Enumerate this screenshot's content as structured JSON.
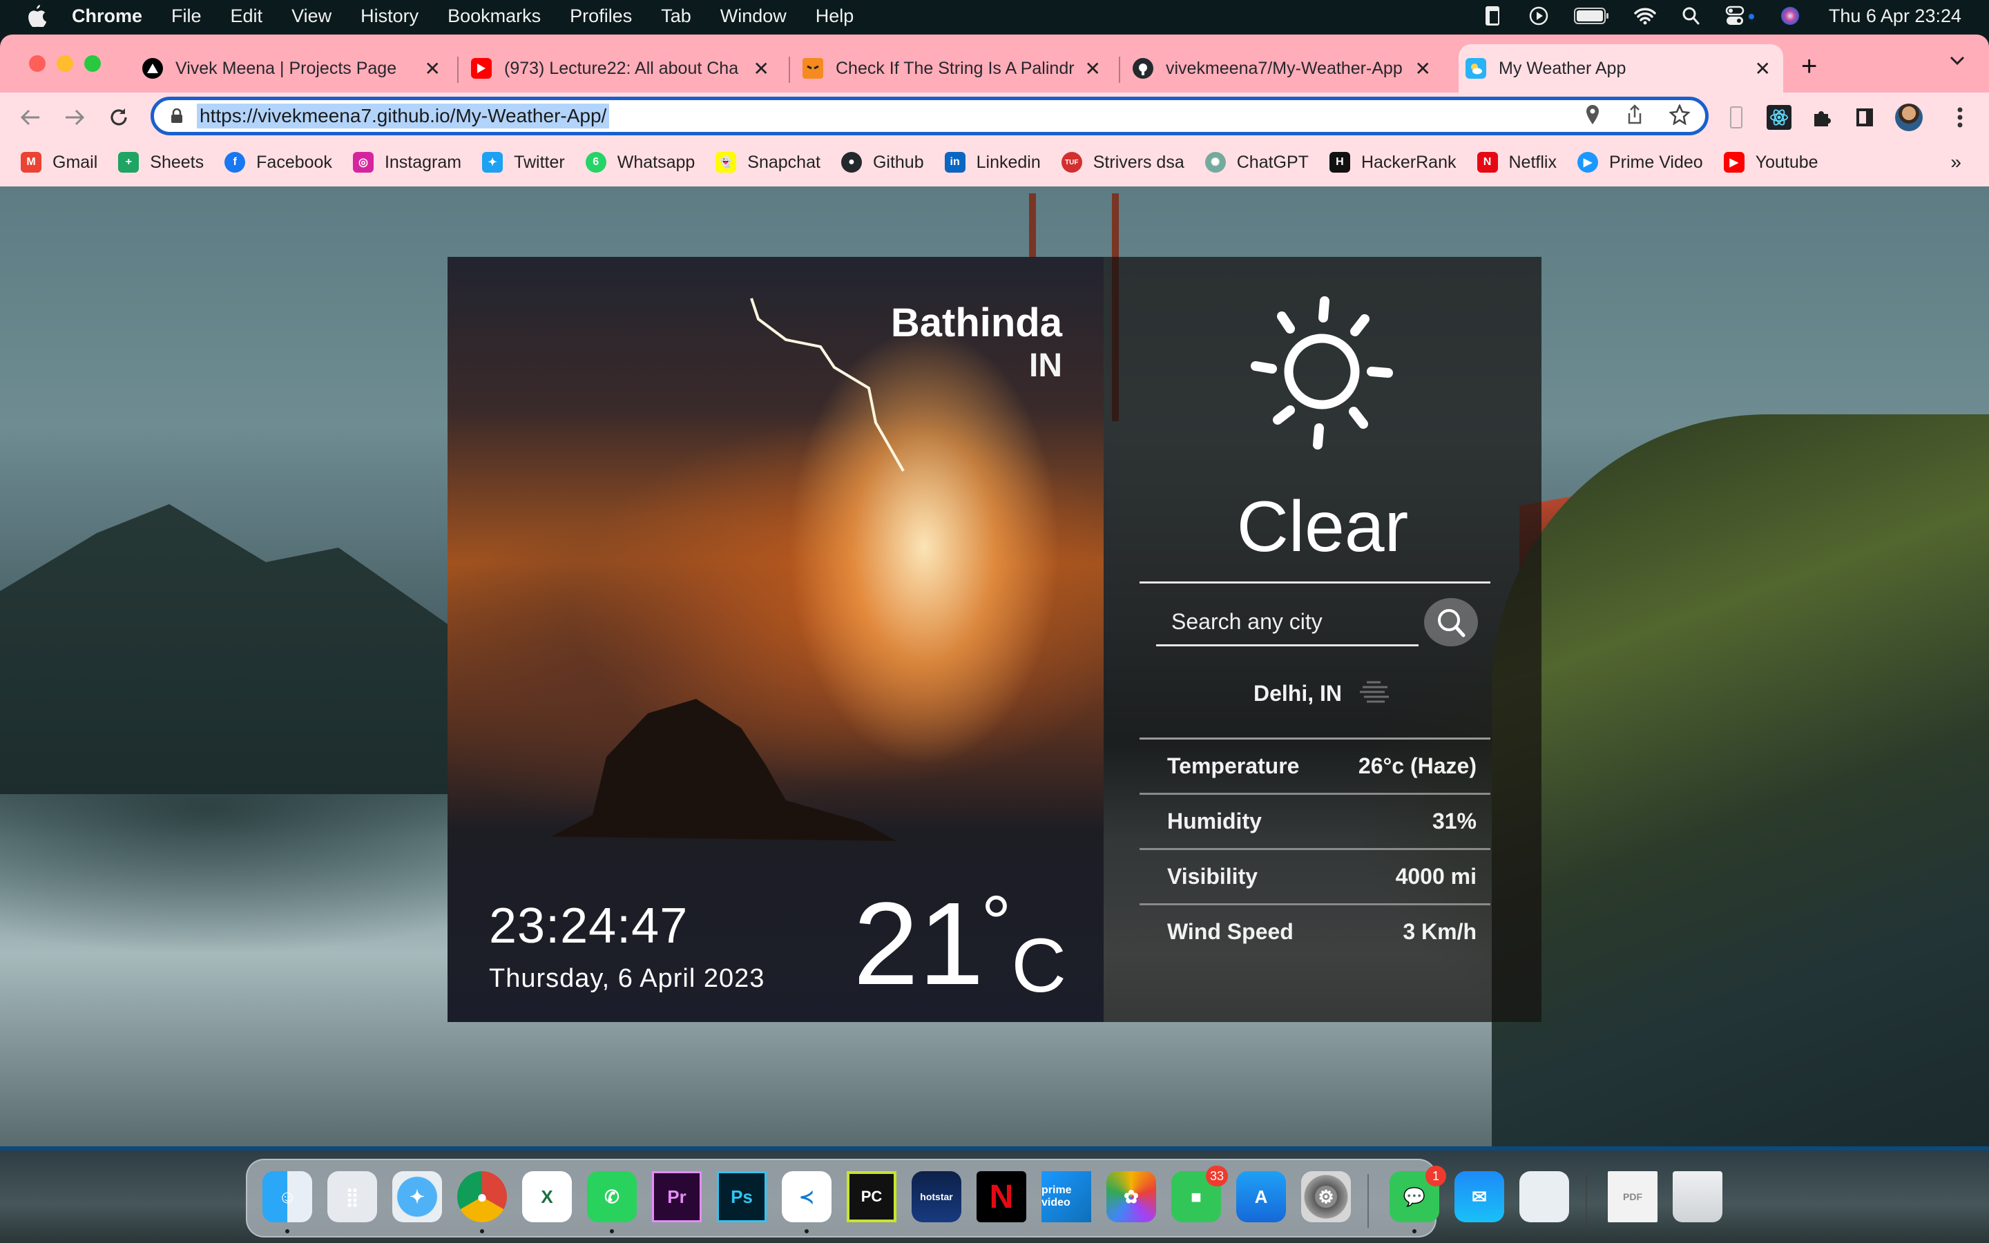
{
  "menubar": {
    "app_name": "Chrome",
    "items": [
      "File",
      "Edit",
      "View",
      "History",
      "Bookmarks",
      "Profiles",
      "Tab",
      "Window",
      "Help"
    ],
    "status_icons": [
      "stage-manager-icon",
      "play-icon",
      "battery-icon",
      "wifi-icon",
      "spotlight-search-icon",
      "control-center-icon",
      "siri-icon"
    ],
    "clock": "Thu 6 Apr  23:24"
  },
  "browser": {
    "tabs": [
      {
        "title": "Vivek Meena | Projects Page",
        "icon": "vercel-icon",
        "active": false
      },
      {
        "title": "(973) Lecture22: All about Cha",
        "icon": "youtube-icon",
        "active": false
      },
      {
        "title": "Check If The String Is A Palindr",
        "icon": "codestudio-icon",
        "active": false
      },
      {
        "title": "vivekmeena7/My-Weather-App",
        "icon": "github-icon",
        "active": false
      },
      {
        "title": "My Weather App",
        "icon": "weather-app-icon",
        "active": true
      }
    ],
    "close_glyph": "✕",
    "new_tab_glyph": "+",
    "tab_search_glyph": "⌄",
    "url": "https://vivekmeena7.github.io/My-Weather-App/",
    "bookmarks": [
      {
        "label": "Gmail",
        "icon": "gmail-icon",
        "color": "#ea4335",
        "glyph": "M"
      },
      {
        "label": "Sheets",
        "icon": "sheets-icon",
        "color": "#1fa463",
        "glyph": "+"
      },
      {
        "label": "Facebook",
        "icon": "facebook-icon",
        "color": "#1877f2",
        "glyph": "f"
      },
      {
        "label": "Instagram",
        "icon": "instagram-icon",
        "color": "#d6249f",
        "glyph": "◎"
      },
      {
        "label": "Twitter",
        "icon": "twitter-icon",
        "color": "#1da1f2",
        "glyph": "✦"
      },
      {
        "label": "Whatsapp",
        "icon": "whatsapp-icon",
        "color": "#25d366",
        "glyph": "6"
      },
      {
        "label": "Snapchat",
        "icon": "snapchat-icon",
        "color": "#fffc00",
        "glyph": "👻"
      },
      {
        "label": "Github",
        "icon": "github-icon",
        "color": "#24292e",
        "glyph": "●"
      },
      {
        "label": "Linkedin",
        "icon": "linkedin-icon",
        "color": "#0a66c2",
        "glyph": "in"
      },
      {
        "label": "Strivers dsa",
        "icon": "takeuforward-icon",
        "color": "#d32f2f",
        "glyph": "TUF"
      },
      {
        "label": "ChatGPT",
        "icon": "chatgpt-icon",
        "color": "#74aa9c",
        "glyph": "✺"
      },
      {
        "label": "HackerRank",
        "icon": "hackerrank-icon",
        "color": "#111111",
        "glyph": "H"
      },
      {
        "label": "Netflix",
        "icon": "netflix-icon",
        "color": "#e50914",
        "glyph": "N"
      },
      {
        "label": "Prime Video",
        "icon": "prime-video-icon",
        "color": "#1a98ff",
        "glyph": "▶"
      },
      {
        "label": "Youtube",
        "icon": "youtube-icon",
        "color": "#ff0000",
        "glyph": "▶"
      }
    ],
    "bookmarks_overflow": "»"
  },
  "weather": {
    "city": "Bathinda",
    "country": "IN",
    "time": "23:24:47",
    "date": "Thursday, 6 April 2023",
    "temperature": "21",
    "degree_symbol": "°",
    "unit": "C",
    "condition": "Clear",
    "condition_icon": "sun-icon",
    "search_placeholder": "Search any city",
    "search_value": "",
    "searched_location": "Delhi, IN",
    "searched_icon": "haze-icon",
    "details": [
      {
        "label": "Temperature",
        "value": "26°c (Haze)"
      },
      {
        "label": "Humidity",
        "value": "31%"
      },
      {
        "label": "Visibility",
        "value": "4000 mi"
      },
      {
        "label": "Wind Speed",
        "value": "3 Km/h"
      }
    ]
  },
  "dock": {
    "apps": [
      {
        "name": "Finder",
        "icon": "finder-icon",
        "running": true
      },
      {
        "name": "Launchpad",
        "icon": "launchpad-icon",
        "running": false
      },
      {
        "name": "Safari",
        "icon": "safari-icon",
        "running": false
      },
      {
        "name": "Google Chrome",
        "icon": "chrome-icon",
        "running": true
      },
      {
        "name": "Microsoft Excel",
        "icon": "excel-icon",
        "running": false
      },
      {
        "name": "WhatsApp",
        "icon": "whatsapp-icon",
        "running": true
      },
      {
        "name": "Adobe Premiere Pro",
        "icon": "premiere-icon",
        "label": "Pr",
        "running": false
      },
      {
        "name": "Adobe Photoshop",
        "icon": "photoshop-icon",
        "label": "Ps",
        "running": false
      },
      {
        "name": "Visual Studio Code",
        "icon": "vscode-icon",
        "running": true
      },
      {
        "name": "PyCharm",
        "icon": "pycharm-icon",
        "label": "PC",
        "running": false
      },
      {
        "name": "Disney+ Hotstar",
        "icon": "hotstar-icon",
        "label": "hotstar",
        "running": false
      },
      {
        "name": "Netflix",
        "icon": "netflix-icon",
        "label": "N",
        "running": false
      },
      {
        "name": "Prime Video",
        "icon": "prime-video-icon",
        "label": "prime video",
        "running": false
      },
      {
        "name": "Photos",
        "icon": "photos-icon",
        "running": false
      },
      {
        "name": "FaceTime",
        "icon": "facetime-icon",
        "badge": "33",
        "running": false
      },
      {
        "name": "App Store",
        "icon": "app-store-icon",
        "running": false
      },
      {
        "name": "System Settings",
        "icon": "system-settings-icon",
        "running": false
      },
      {
        "name": "Messages",
        "icon": "messages-icon",
        "badge": "1",
        "running": true
      },
      {
        "name": "Mail",
        "icon": "mail-icon",
        "running": false
      },
      {
        "name": "Preview",
        "icon": "preview-icon",
        "running": false
      },
      {
        "name": "PDF Document",
        "icon": "pdf-document-icon",
        "label": "PDF",
        "running": false
      },
      {
        "name": "Trash",
        "icon": "trash-icon",
        "running": false
      }
    ]
  }
}
